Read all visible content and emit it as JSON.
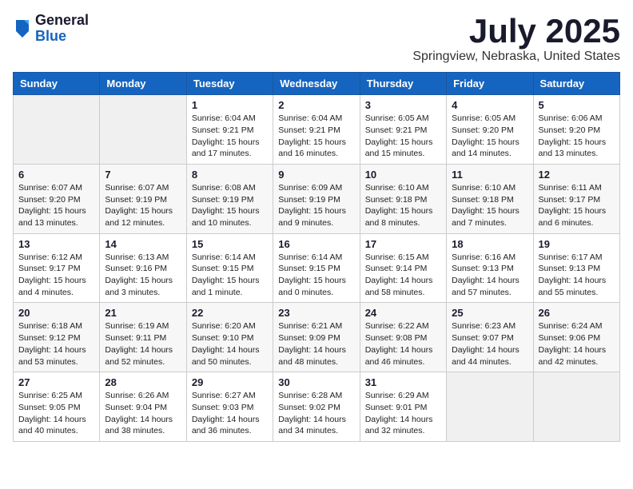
{
  "header": {
    "logo_general": "General",
    "logo_blue": "Blue",
    "month": "July 2025",
    "location": "Springview, Nebraska, United States"
  },
  "days_of_week": [
    "Sunday",
    "Monday",
    "Tuesday",
    "Wednesday",
    "Thursday",
    "Friday",
    "Saturday"
  ],
  "weeks": [
    [
      {
        "day": "",
        "info": ""
      },
      {
        "day": "",
        "info": ""
      },
      {
        "day": "1",
        "info": "Sunrise: 6:04 AM\nSunset: 9:21 PM\nDaylight: 15 hours\nand 17 minutes."
      },
      {
        "day": "2",
        "info": "Sunrise: 6:04 AM\nSunset: 9:21 PM\nDaylight: 15 hours\nand 16 minutes."
      },
      {
        "day": "3",
        "info": "Sunrise: 6:05 AM\nSunset: 9:21 PM\nDaylight: 15 hours\nand 15 minutes."
      },
      {
        "day": "4",
        "info": "Sunrise: 6:05 AM\nSunset: 9:20 PM\nDaylight: 15 hours\nand 14 minutes."
      },
      {
        "day": "5",
        "info": "Sunrise: 6:06 AM\nSunset: 9:20 PM\nDaylight: 15 hours\nand 13 minutes."
      }
    ],
    [
      {
        "day": "6",
        "info": "Sunrise: 6:07 AM\nSunset: 9:20 PM\nDaylight: 15 hours\nand 13 minutes."
      },
      {
        "day": "7",
        "info": "Sunrise: 6:07 AM\nSunset: 9:19 PM\nDaylight: 15 hours\nand 12 minutes."
      },
      {
        "day": "8",
        "info": "Sunrise: 6:08 AM\nSunset: 9:19 PM\nDaylight: 15 hours\nand 10 minutes."
      },
      {
        "day": "9",
        "info": "Sunrise: 6:09 AM\nSunset: 9:19 PM\nDaylight: 15 hours\nand 9 minutes."
      },
      {
        "day": "10",
        "info": "Sunrise: 6:10 AM\nSunset: 9:18 PM\nDaylight: 15 hours\nand 8 minutes."
      },
      {
        "day": "11",
        "info": "Sunrise: 6:10 AM\nSunset: 9:18 PM\nDaylight: 15 hours\nand 7 minutes."
      },
      {
        "day": "12",
        "info": "Sunrise: 6:11 AM\nSunset: 9:17 PM\nDaylight: 15 hours\nand 6 minutes."
      }
    ],
    [
      {
        "day": "13",
        "info": "Sunrise: 6:12 AM\nSunset: 9:17 PM\nDaylight: 15 hours\nand 4 minutes."
      },
      {
        "day": "14",
        "info": "Sunrise: 6:13 AM\nSunset: 9:16 PM\nDaylight: 15 hours\nand 3 minutes."
      },
      {
        "day": "15",
        "info": "Sunrise: 6:14 AM\nSunset: 9:15 PM\nDaylight: 15 hours\nand 1 minute."
      },
      {
        "day": "16",
        "info": "Sunrise: 6:14 AM\nSunset: 9:15 PM\nDaylight: 15 hours\nand 0 minutes."
      },
      {
        "day": "17",
        "info": "Sunrise: 6:15 AM\nSunset: 9:14 PM\nDaylight: 14 hours\nand 58 minutes."
      },
      {
        "day": "18",
        "info": "Sunrise: 6:16 AM\nSunset: 9:13 PM\nDaylight: 14 hours\nand 57 minutes."
      },
      {
        "day": "19",
        "info": "Sunrise: 6:17 AM\nSunset: 9:13 PM\nDaylight: 14 hours\nand 55 minutes."
      }
    ],
    [
      {
        "day": "20",
        "info": "Sunrise: 6:18 AM\nSunset: 9:12 PM\nDaylight: 14 hours\nand 53 minutes."
      },
      {
        "day": "21",
        "info": "Sunrise: 6:19 AM\nSunset: 9:11 PM\nDaylight: 14 hours\nand 52 minutes."
      },
      {
        "day": "22",
        "info": "Sunrise: 6:20 AM\nSunset: 9:10 PM\nDaylight: 14 hours\nand 50 minutes."
      },
      {
        "day": "23",
        "info": "Sunrise: 6:21 AM\nSunset: 9:09 PM\nDaylight: 14 hours\nand 48 minutes."
      },
      {
        "day": "24",
        "info": "Sunrise: 6:22 AM\nSunset: 9:08 PM\nDaylight: 14 hours\nand 46 minutes."
      },
      {
        "day": "25",
        "info": "Sunrise: 6:23 AM\nSunset: 9:07 PM\nDaylight: 14 hours\nand 44 minutes."
      },
      {
        "day": "26",
        "info": "Sunrise: 6:24 AM\nSunset: 9:06 PM\nDaylight: 14 hours\nand 42 minutes."
      }
    ],
    [
      {
        "day": "27",
        "info": "Sunrise: 6:25 AM\nSunset: 9:05 PM\nDaylight: 14 hours\nand 40 minutes."
      },
      {
        "day": "28",
        "info": "Sunrise: 6:26 AM\nSunset: 9:04 PM\nDaylight: 14 hours\nand 38 minutes."
      },
      {
        "day": "29",
        "info": "Sunrise: 6:27 AM\nSunset: 9:03 PM\nDaylight: 14 hours\nand 36 minutes."
      },
      {
        "day": "30",
        "info": "Sunrise: 6:28 AM\nSunset: 9:02 PM\nDaylight: 14 hours\nand 34 minutes."
      },
      {
        "day": "31",
        "info": "Sunrise: 6:29 AM\nSunset: 9:01 PM\nDaylight: 14 hours\nand 32 minutes."
      },
      {
        "day": "",
        "info": ""
      },
      {
        "day": "",
        "info": ""
      }
    ]
  ]
}
